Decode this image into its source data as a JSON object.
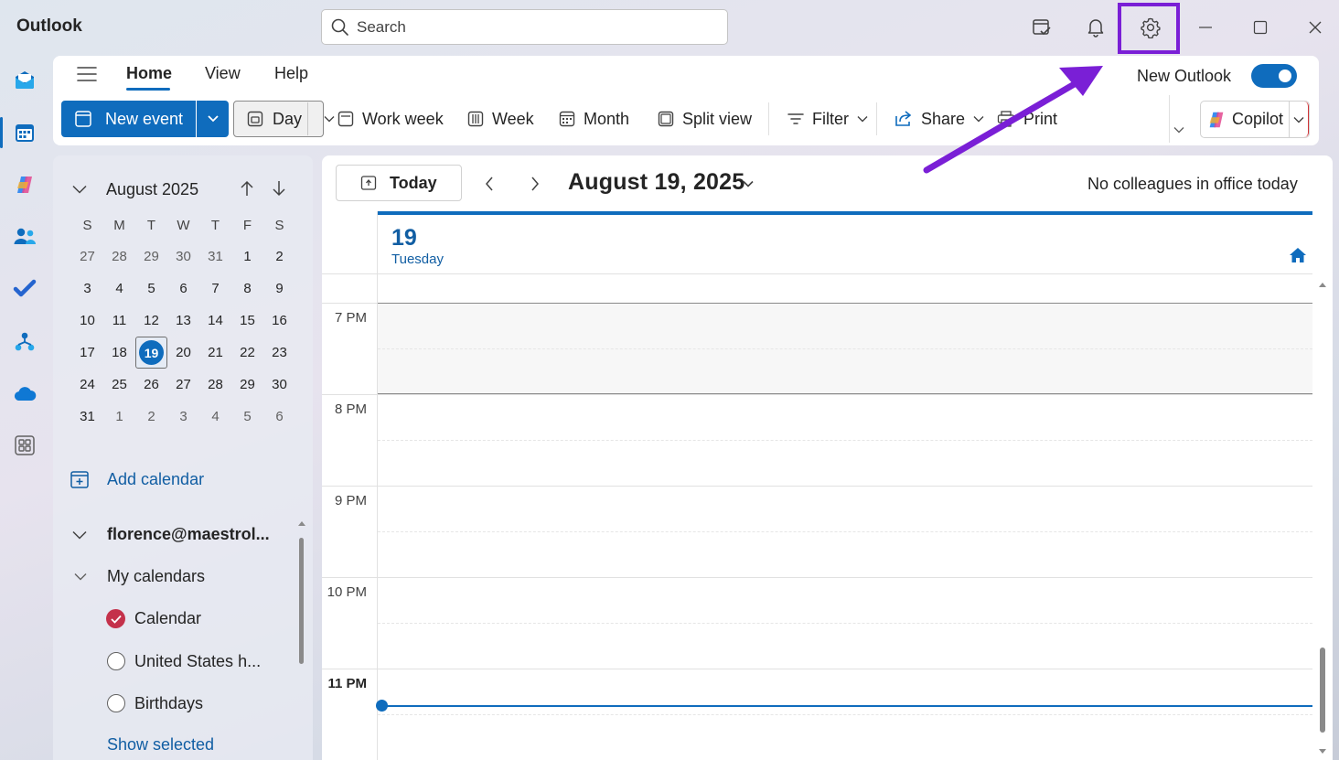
{
  "app": {
    "title": "Outlook"
  },
  "search": {
    "placeholder": "Search"
  },
  "titlebar": {
    "icons": [
      "my-day-icon",
      "bell-icon",
      "gear-icon",
      "minimize-icon",
      "maximize-icon",
      "close-icon"
    ]
  },
  "rail": {
    "icons": [
      "mail-icon",
      "calendar-icon",
      "copilot-icon",
      "people-icon",
      "todo-icon",
      "org-explorer-icon",
      "onedrive-icon",
      "more-apps-icon"
    ]
  },
  "ribbon": {
    "tabs": [
      "Home",
      "View",
      "Help"
    ],
    "new_outlook_label": "New Outlook",
    "new_outlook_on": true,
    "new_event": "New event",
    "views": {
      "day": "Day",
      "work_week": "Work week",
      "week": "Week",
      "month": "Month",
      "split": "Split view"
    },
    "filter": "Filter",
    "share": "Share",
    "print": "Print",
    "copilot": "Copilot"
  },
  "mini_calendar": {
    "month": "August 2025",
    "weekdays": [
      "S",
      "M",
      "T",
      "W",
      "T",
      "F",
      "S"
    ],
    "weeks": [
      [
        "27",
        "28",
        "29",
        "30",
        "31",
        "1",
        "2"
      ],
      [
        "3",
        "4",
        "5",
        "6",
        "7",
        "8",
        "9"
      ],
      [
        "10",
        "11",
        "12",
        "13",
        "14",
        "15",
        "16"
      ],
      [
        "17",
        "18",
        "19",
        "20",
        "21",
        "22",
        "23"
      ],
      [
        "24",
        "25",
        "26",
        "27",
        "28",
        "29",
        "30"
      ],
      [
        "31",
        "1",
        "2",
        "3",
        "4",
        "5",
        "6"
      ]
    ],
    "selected": "19"
  },
  "sidebar": {
    "add_calendar": "Add calendar",
    "account": "florence@maestrol...",
    "my_calendars": "My calendars",
    "calendars": [
      {
        "name": "Calendar",
        "checked": true,
        "color": "#c4314b"
      },
      {
        "name": "United States h...",
        "checked": false
      },
      {
        "name": "Birthdays",
        "checked": false
      }
    ],
    "show_selected": "Show selected"
  },
  "main": {
    "today": "Today",
    "date_title": "August 19, 2025",
    "colleagues": "No colleagues in office today",
    "day_number": "19",
    "day_name": "Tuesday",
    "time_labels": [
      "7 PM",
      "8 PM",
      "9 PM",
      "10 PM",
      "11 PM"
    ]
  },
  "colors": {
    "accent": "#0f6cbd",
    "annotation": "#7a1fd6"
  }
}
